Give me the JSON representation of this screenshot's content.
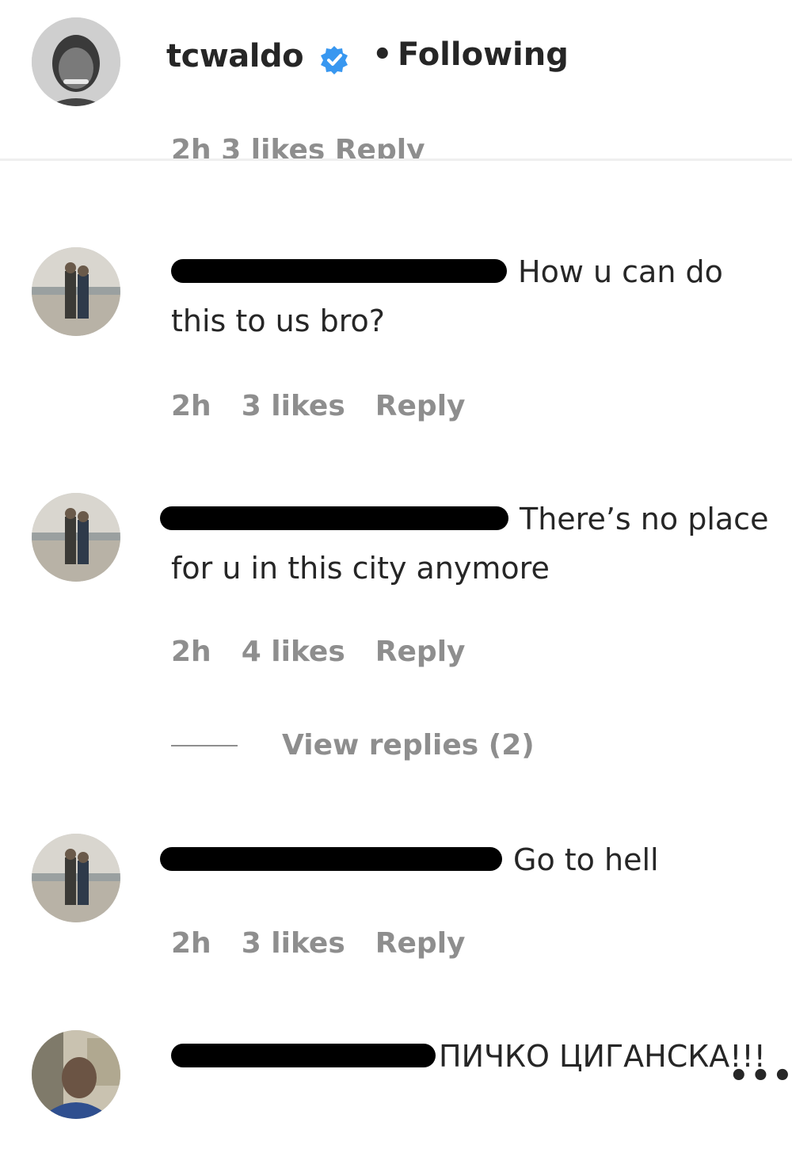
{
  "header": {
    "username": "tcwaldo",
    "separator": "•",
    "follow_status": "Following",
    "verified_icon": "verified-badge-icon",
    "verified_color": "#3897f0"
  },
  "partial_meta": "2h 3 likes Reply",
  "comments": [
    {
      "text": "How u can do this to us bro?",
      "time": "2h",
      "likes": "3 likes",
      "reply": "Reply"
    },
    {
      "text": "There’s no place for u in this city anymore",
      "time": "2h",
      "likes": "4 likes",
      "reply": "Reply",
      "view_replies": "View replies (2)"
    },
    {
      "text": "Go to hell",
      "time": "2h",
      "likes": "3 likes",
      "reply": "Reply"
    },
    {
      "text": "ПИЧКО ЦИГАНСКА!!!",
      "more_icon": "more-options-icon"
    }
  ],
  "colors": {
    "primary_text": "#262626",
    "secondary_text": "#8e8e8e",
    "divider": "#efefef"
  }
}
